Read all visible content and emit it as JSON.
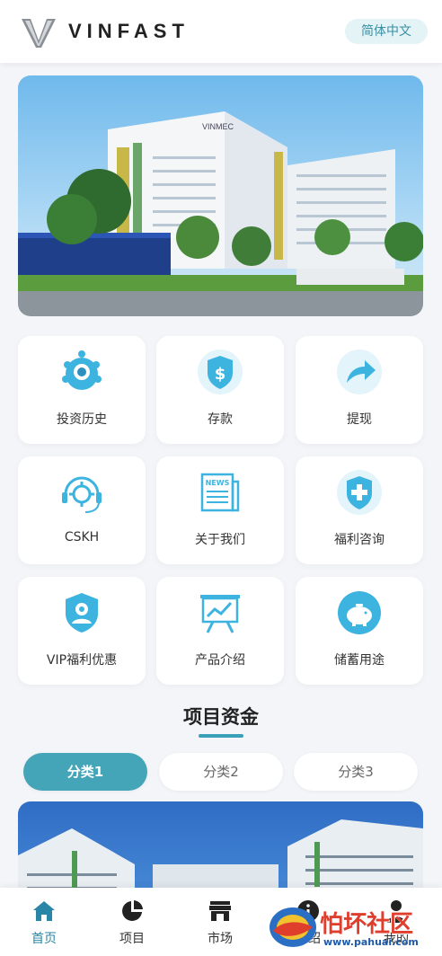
{
  "header": {
    "brand": "VINFAST",
    "language_button": "简体中文"
  },
  "hero": {
    "image_description_icon": "hospital-building-photo",
    "sign_text": "VINMEC"
  },
  "menu": [
    {
      "label": "投资历史",
      "icon": "investment-history-icon"
    },
    {
      "label": "存款",
      "icon": "deposit-shield-dollar-icon"
    },
    {
      "label": "提现",
      "icon": "withdraw-arrow-icon"
    },
    {
      "label": "CSKH",
      "icon": "customer-service-headset-icon"
    },
    {
      "label": "关于我们",
      "icon": "news-icon"
    },
    {
      "label": "福利咨询",
      "icon": "welfare-plus-icon"
    },
    {
      "label": "VIP福利优惠",
      "icon": "vip-shield-user-icon"
    },
    {
      "label": "产品介绍",
      "icon": "presentation-chart-icon"
    },
    {
      "label": "储蓄用途",
      "icon": "piggy-bank-icon"
    }
  ],
  "section": {
    "title": "项目资金",
    "tabs": [
      "分类1",
      "分类2",
      "分类3"
    ],
    "active_tab": 0
  },
  "bottom_nav": [
    {
      "label": "首页",
      "icon": "home-icon",
      "active": true
    },
    {
      "label": "项目",
      "icon": "pie-chart-icon",
      "active": false
    },
    {
      "label": "市场",
      "icon": "store-icon",
      "active": false
    },
    {
      "label": "介绍",
      "icon": "info-icon",
      "active": false
    },
    {
      "label": "我的",
      "icon": "user-icon",
      "active": false
    }
  ],
  "watermark": {
    "title": "怕坏社区",
    "url": "www.pahuai.com"
  },
  "colors": {
    "accent": "#45a5b8",
    "icon_blue": "#3db3e0",
    "background": "#f3f5f8"
  }
}
